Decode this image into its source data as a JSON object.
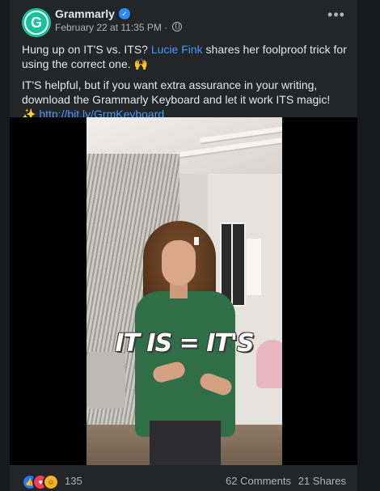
{
  "post": {
    "page_name": "Grammarly",
    "avatar_letter": "G",
    "timestamp": "February 22 at 11:35 PM",
    "separator": "·",
    "text_line1_pre": "Hung up on IT'S vs. ITS? ",
    "text_line1_link": "Lucie Fink",
    "text_line1_post": " shares her foolproof trick for using the correct one. 🙌",
    "text_line2": "IT'S helpful, but if you want extra assurance in your writing, download the Grammarly Keyboard and let it work ITS magic!",
    "sparkle": "✨",
    "url": "http://bit.ly/GrmKeyboard"
  },
  "video": {
    "overlay_text": "IT IS = IT'S"
  },
  "footer": {
    "reaction_count": "135",
    "comments": "62 Comments",
    "shares": "21 Shares"
  },
  "colors": {
    "brand": "#15c39a",
    "link": "#4599ff",
    "background": "#242526"
  },
  "icons": {
    "verified": "verified-badge-icon",
    "audience": "globe-icon",
    "more": "more-options-icon"
  }
}
